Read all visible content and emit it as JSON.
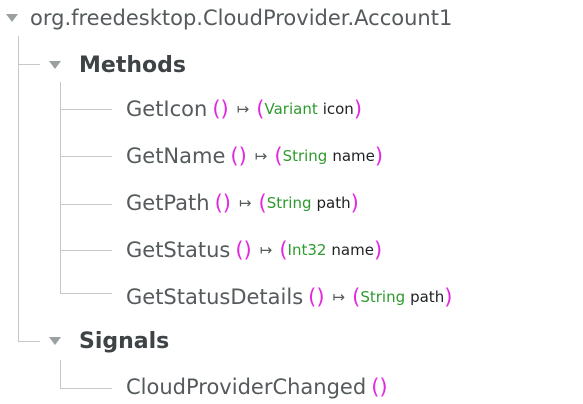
{
  "interface": {
    "label": "org.freedesktop.CloudProvider.Account1",
    "expander_icon": "expander-triangle-down"
  },
  "methods_group": {
    "label": "Methods",
    "expander_icon": "expander-triangle-down"
  },
  "methods": [
    {
      "name": "GetIcon",
      "params": "()",
      "arrow": "↦",
      "ret_open": "(",
      "ret_type": "Variant",
      "ret_name": "icon",
      "ret_close": ")"
    },
    {
      "name": "GetName",
      "params": "()",
      "arrow": "↦",
      "ret_open": "(",
      "ret_type": "String",
      "ret_name": "name",
      "ret_close": ")"
    },
    {
      "name": "GetPath",
      "params": "()",
      "arrow": "↦",
      "ret_open": "(",
      "ret_type": "String",
      "ret_name": "path",
      "ret_close": ")"
    },
    {
      "name": "GetStatus",
      "params": "()",
      "arrow": "↦",
      "ret_open": "(",
      "ret_type": "Int32",
      "ret_name": "name",
      "ret_close": ")"
    },
    {
      "name": "GetStatusDetails",
      "params": "()",
      "arrow": "↦",
      "ret_open": "(",
      "ret_type": "String",
      "ret_name": "path",
      "ret_close": ")"
    }
  ],
  "signals_group": {
    "label": "Signals",
    "expander_icon": "expander-triangle-down"
  },
  "signals": [
    {
      "name": "CloudProviderChanged",
      "params": "()"
    }
  ],
  "colors": {
    "name_text": "#555a5c",
    "group_text": "#3e4345",
    "punctuation": "#e12ae0",
    "type_text": "#2e9b2e",
    "param_text": "#1e2022",
    "tree_lines": "#c7c7c7",
    "expander": "#9aa0a2"
  }
}
